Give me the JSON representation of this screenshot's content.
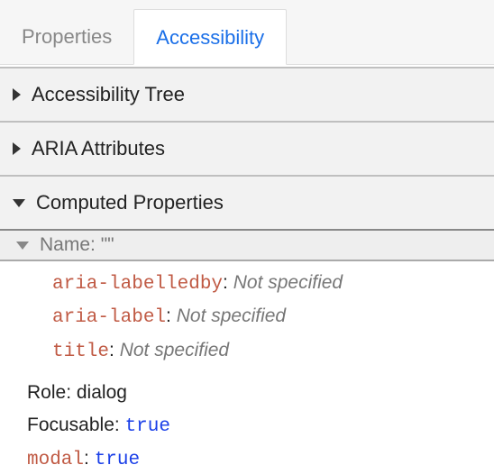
{
  "tabs": {
    "properties": "Properties",
    "accessibility": "Accessibility"
  },
  "sections": {
    "tree": "Accessibility Tree",
    "aria": "ARIA Attributes",
    "computed": "Computed Properties"
  },
  "computed": {
    "name": {
      "label": "Name:",
      "value": "\"\""
    },
    "attrs": {
      "labelledby": {
        "key": "aria-labelledby",
        "value": "Not specified"
      },
      "label": {
        "key": "aria-label",
        "value": "Not specified"
      },
      "title": {
        "key": "title",
        "value": "Not specified"
      }
    },
    "role": {
      "label": "Role:",
      "value": "dialog"
    },
    "focusable": {
      "label": "Focusable:",
      "value": "true"
    },
    "modal": {
      "label": "modal",
      "value": "true"
    }
  }
}
